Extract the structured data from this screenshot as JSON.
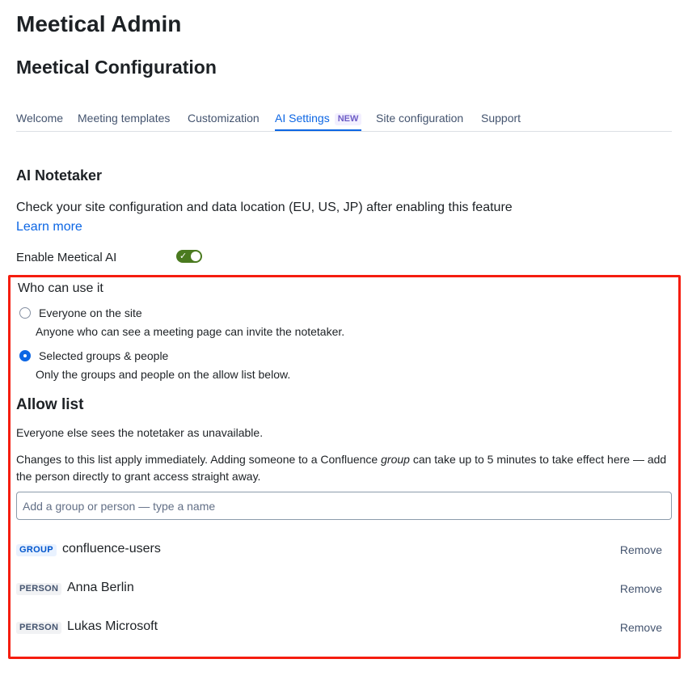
{
  "app": {
    "title": "Meetical Admin"
  },
  "page": {
    "title": "Meetical Configuration"
  },
  "tabs": [
    {
      "label": "Welcome"
    },
    {
      "label": "Meeting templates"
    },
    {
      "label": "Customization"
    },
    {
      "label": "AI Settings",
      "badge": "NEW",
      "active": true
    },
    {
      "label": "Site configuration"
    },
    {
      "label": "Support"
    }
  ],
  "notetaker": {
    "title": "AI Notetaker",
    "description": "Check your site configuration and data location (EU, US, JP) after enabling this feature",
    "learn_more": "Learn more",
    "enable_label": "Enable Meetical AI",
    "enabled": true
  },
  "who": {
    "title": "Who can use it",
    "options": [
      {
        "label": "Everyone on the site",
        "help": "Anyone who can see a meeting page can invite the notetaker.",
        "checked": false
      },
      {
        "label": "Selected groups & people",
        "help": "Only the groups and people on the allow list below.",
        "checked": true
      }
    ]
  },
  "allow_list": {
    "title": "Allow list",
    "desc1": "Everyone else sees the notetaker as unavailable.",
    "desc2_a": "Changes to this list apply immediately. Adding someone to a Confluence ",
    "desc2_em": "group",
    "desc2_b": " can take up to 5 minutes to take effect here — add the person directly to grant access straight away.",
    "placeholder": "Add a group or person — type a name",
    "entries": [
      {
        "type": "GROUP",
        "name": "confluence-users",
        "action": "Remove"
      },
      {
        "type": "PERSON",
        "name": "Anna Berlin",
        "action": "Remove"
      },
      {
        "type": "PERSON",
        "name": "Lukas Microsoft",
        "action": "Remove"
      }
    ]
  },
  "colors": {
    "accent": "#0c66e4",
    "toggle_on": "#4a7a1f",
    "highlight": "#f51d0f",
    "new_badge": "#6e5dc6"
  }
}
